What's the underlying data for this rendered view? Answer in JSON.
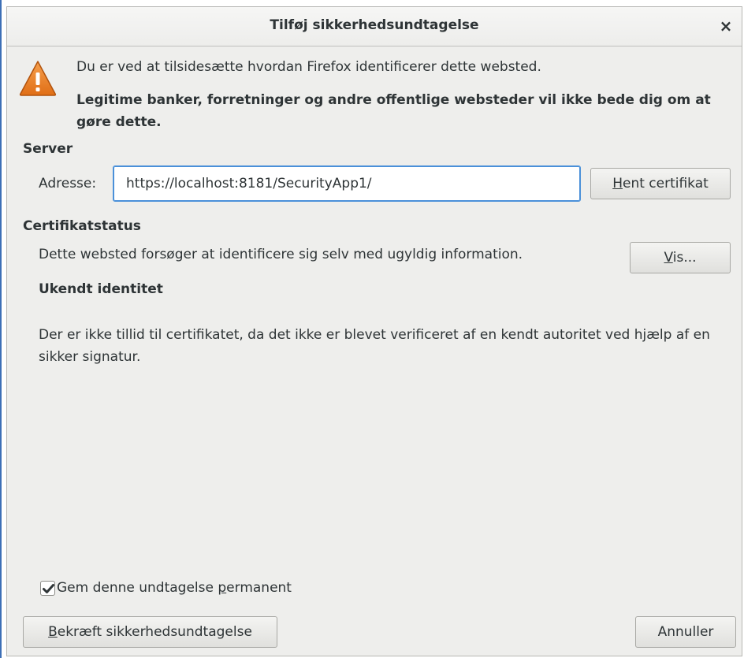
{
  "window": {
    "title": "Tilføj sikkerhedsundtagelse",
    "close_glyph": "×"
  },
  "warning": {
    "icon": "warning-icon",
    "line1": "Du er ved at tilsidesætte hvordan Firefox identificerer dette websted.",
    "line2": "Legitime banker, forretninger og andre offentlige websteder vil ikke bede dig om at gøre dette."
  },
  "server": {
    "title": "Server",
    "address_label": "Adresse:",
    "address_value": "https://localhost:8181/SecurityApp1/",
    "get_cert_button": {
      "mnemonic": "H",
      "rest": "ent certifikat"
    }
  },
  "cert_status": {
    "title": "Certifikatstatus",
    "info": "Dette websted forsøger at identificere sig selv med ugyldig information.",
    "view_button": {
      "mnemonic": "V",
      "rest": "is..."
    },
    "identity_title": "Ukendt identitet",
    "identity_desc": "Der er ikke tillid til certifikatet, da det ikke er blevet verificeret af en kendt autoritet ved hjælp af en sikker signatur."
  },
  "permanent": {
    "checked": true,
    "label_before": "Gem denne undtagelse ",
    "mnemonic": "p",
    "label_after": "ermanent"
  },
  "footer": {
    "confirm_button": {
      "mnemonic": "B",
      "rest": "ekræft sikkerhedsundtagelse"
    },
    "cancel_label": "Annuller"
  },
  "colors": {
    "dialog_bg": "#eeeeec",
    "focus_border": "#4a90d9",
    "warning_orange": "#e8761f"
  }
}
